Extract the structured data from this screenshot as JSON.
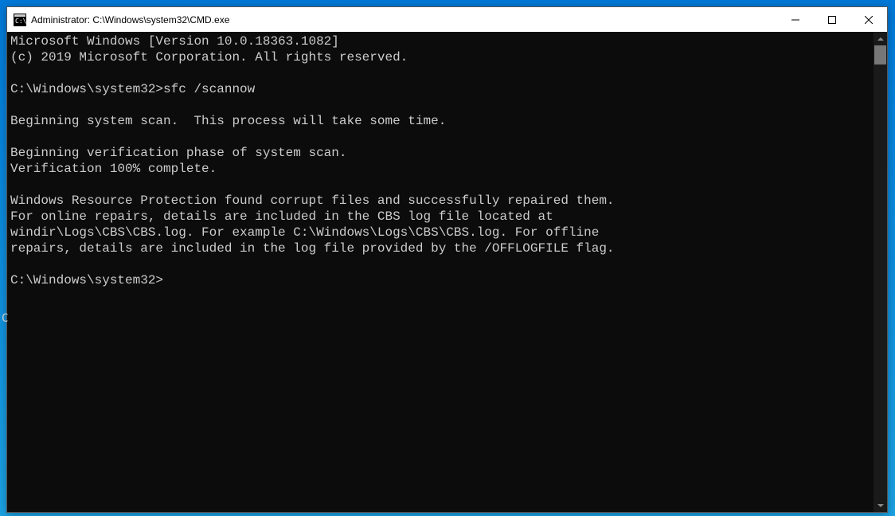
{
  "titlebar": {
    "title": "Administrator: C:\\Windows\\system32\\CMD.exe"
  },
  "console": {
    "lines": [
      "Microsoft Windows [Version 10.0.18363.1082]",
      "(c) 2019 Microsoft Corporation. All rights reserved.",
      "",
      "C:\\Windows\\system32>sfc /scannow",
      "",
      "Beginning system scan.  This process will take some time.",
      "",
      "Beginning verification phase of system scan.",
      "Verification 100% complete.",
      "",
      "Windows Resource Protection found corrupt files and successfully repaired them.",
      "For online repairs, details are included in the CBS log file located at",
      "windir\\Logs\\CBS\\CBS.log. For example C:\\Windows\\Logs\\CBS\\CBS.log. For offline",
      "repairs, details are included in the log file provided by the /OFFLOGFILE flag.",
      "",
      "C:\\Windows\\system32>",
      "",
      ""
    ]
  }
}
